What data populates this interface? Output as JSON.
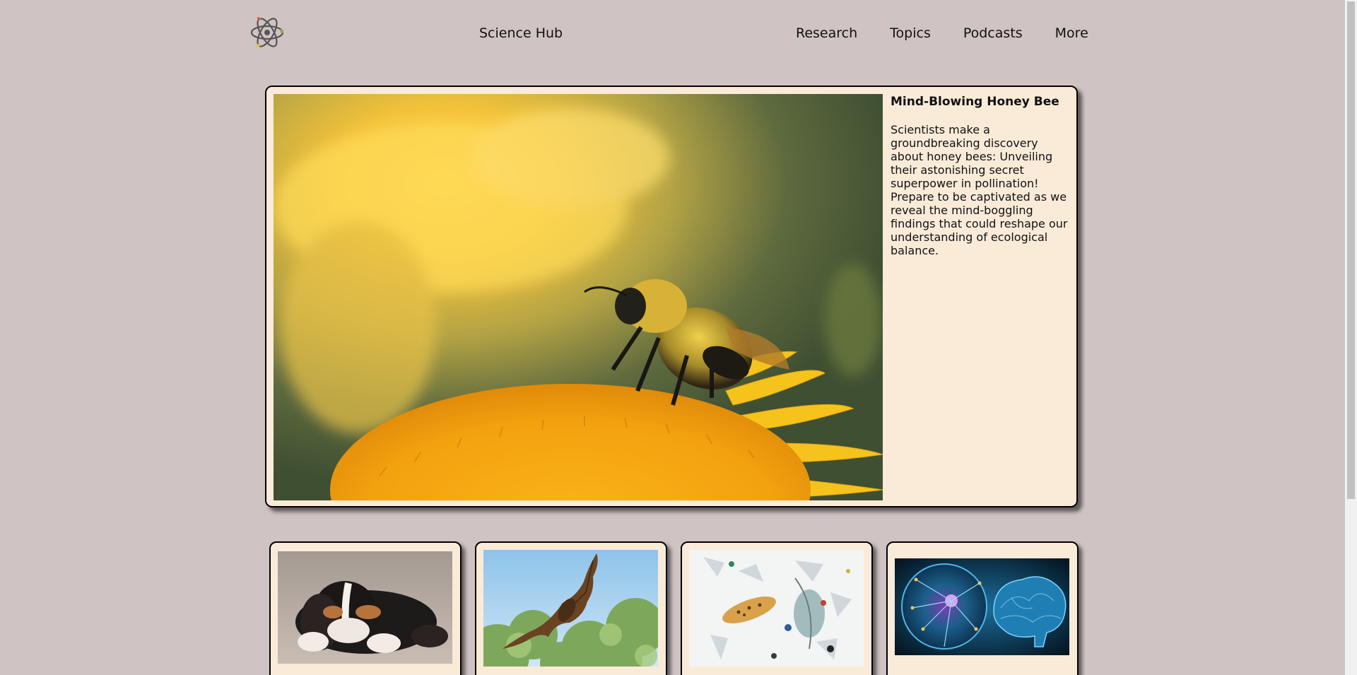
{
  "header": {
    "site_title": "Science Hub",
    "nav": [
      "Research",
      "Topics",
      "Podcasts",
      "More"
    ],
    "logo_icon": "atom-icon"
  },
  "featured": {
    "title": "Mind-Blowing Honey Bee",
    "body": "Scientists make a groundbreaking discovery about honey bees: Unveiling their astonishing secret superpower in pollination! Prepare to be captivated as we reveal the mind-boggling findings that could reshape our understanding of ecological balance.",
    "image": "bee-on-flower-photo"
  },
  "cards": [
    {
      "image": "puppy-photo"
    },
    {
      "image": "flying-bat-photo"
    },
    {
      "image": "microplastics-photo"
    },
    {
      "image": "neuron-brain-photo"
    }
  ],
  "colors": {
    "background": "#cfc3c3",
    "card": "#faebd9",
    "border": "#000000"
  }
}
